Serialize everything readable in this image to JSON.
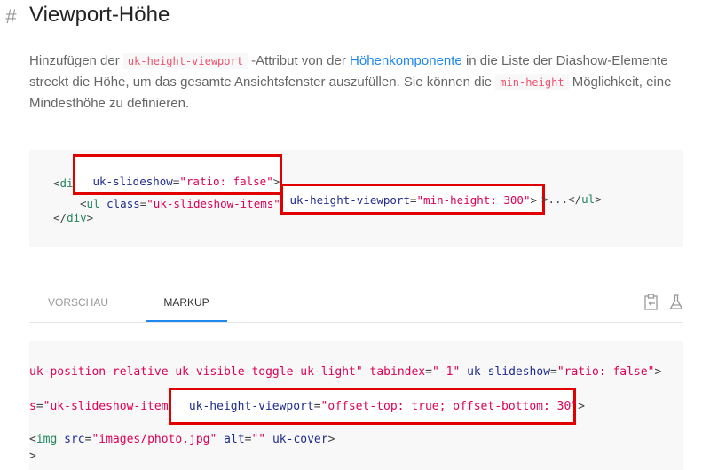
{
  "heading": {
    "hash": "#",
    "title": "Viewport-Höhe"
  },
  "paragraph": {
    "t1": "Hinzufügen der ",
    "code1": "uk-height-viewport",
    "t2": " -Attribut von der ",
    "link": "Höhenkomponente",
    "t3": " in die Liste der Diashow-Elemente streckt die Höhe, um das gesamte Ansichtsfenster auszufüllen. Sie können die ",
    "code2": "min-height",
    "t4": " Möglichkeit, eine Mindesthöhe zu definieren."
  },
  "code1": {
    "l1_lt": "<",
    "l1_tag": "div",
    "l1_attr": " uk-slideshow",
    "l1_eq": "=",
    "l1_str": "\"ratio: false\"",
    "l1_gt": ">",
    "l2_lt": "<",
    "l2_tag": "ul",
    "l2_attr": " class",
    "l2_eq": "=",
    "l2_str": "\"uk-slideshow-items\"",
    "l2_attr2": " uk-height-viewport",
    "l2_eq2": "=",
    "l2_str2": "\"min-height: 300\"",
    "l2_rest": ">...</",
    "l2_tag2": "ul",
    "l2_gt": ">",
    "l3_lt": "</",
    "l3_tag": "div",
    "l3_gt": ">"
  },
  "tabs": [
    {
      "label": "Vorschau"
    },
    {
      "label": "Markup"
    }
  ],
  "toolbar": {
    "copy_icon": "clipboard-icon",
    "lab_icon": "flask-icon"
  },
  "code2": {
    "l1_a": "uk-position-relative uk-visible-toggle uk-light",
    "l1_b": "\" tabindex",
    "l1_eq": "=",
    "l1_s": "\"-1\"",
    "l1_c": " uk-slideshow",
    "l1_eq2": "=",
    "l1_s2": "\"ratio: false\"",
    "l1_gt": ">",
    "l2_a": "s",
    "l2_eq": "=",
    "l2_s": "\"uk-slideshow-items\"",
    "l2_b": " uk-height-viewport",
    "l2_eq2": "=",
    "l2_s2": "\"offset-top: true; offset-bottom: 30\"",
    "l2_gt": ">",
    "l3_lt": "<",
    "l3_tag": "img",
    "l3_a": " src",
    "l3_eq": "=",
    "l3_s": "\"images/photo.jpg\"",
    "l3_b": " alt",
    "l3_eq2": "=",
    "l3_s2": "\"\"",
    "l3_c": " uk-cover",
    "l3_gt": ">",
    "l4": ">"
  },
  "colors": {
    "accent": "#1e87f0",
    "code_pink": "#f0506e",
    "highlight": "#e10000"
  }
}
